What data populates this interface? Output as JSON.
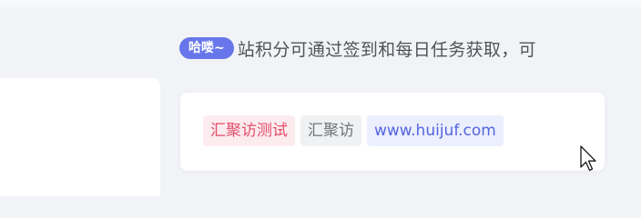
{
  "notice": {
    "badge": "哈喽~",
    "text": "站积分可通过签到和每日任务获取，可"
  },
  "tags": [
    {
      "label": "汇聚访测试",
      "style": "red"
    },
    {
      "label": "汇聚访",
      "style": "grey"
    },
    {
      "label": "www.huijuf.com",
      "style": "blue"
    }
  ],
  "colors": {
    "badge_bg": "#6776ea",
    "tag_red": "#e24d6a",
    "tag_blue": "#5565e0",
    "page_bg": "#f2f3f6"
  },
  "icons": {
    "cursor": "arrow-cursor-icon"
  }
}
